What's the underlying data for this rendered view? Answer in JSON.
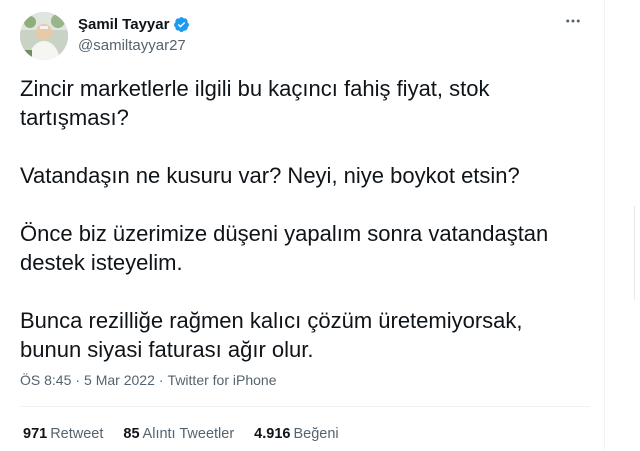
{
  "author": {
    "display_name": "Şamil Tayyar",
    "handle": "@samiltayyar27",
    "verified": true
  },
  "icons": {
    "verified": "verified-badge-icon",
    "more": "more-options-icon",
    "verified_color": "#1d9bf0"
  },
  "tweet": {
    "paragraphs": [
      "Zincir marketlerle ilgili bu kaçıncı fahiş fiyat, stok\ntartışması?",
      "Vatandaşın ne kusuru var? Neyi, niye boykot etsin?",
      "Önce biz üzerimize düşeni yapalım sonra vatandaştan\ndestek isteyelim.",
      "Bunca rezilliğe rağmen kalıcı çözüm üretemiyorsak,\nbunun siyasi faturası ağır olur."
    ],
    "time": "ÖS 8:45",
    "date": "5 Mar 2022",
    "source": "Twitter for iPhone",
    "separator": "·"
  },
  "stats": [
    {
      "count": "971",
      "label": "Retweet"
    },
    {
      "count": "85",
      "label": "Alıntı Tweetler"
    },
    {
      "count": "4.916",
      "label": "Beğeni"
    }
  ]
}
